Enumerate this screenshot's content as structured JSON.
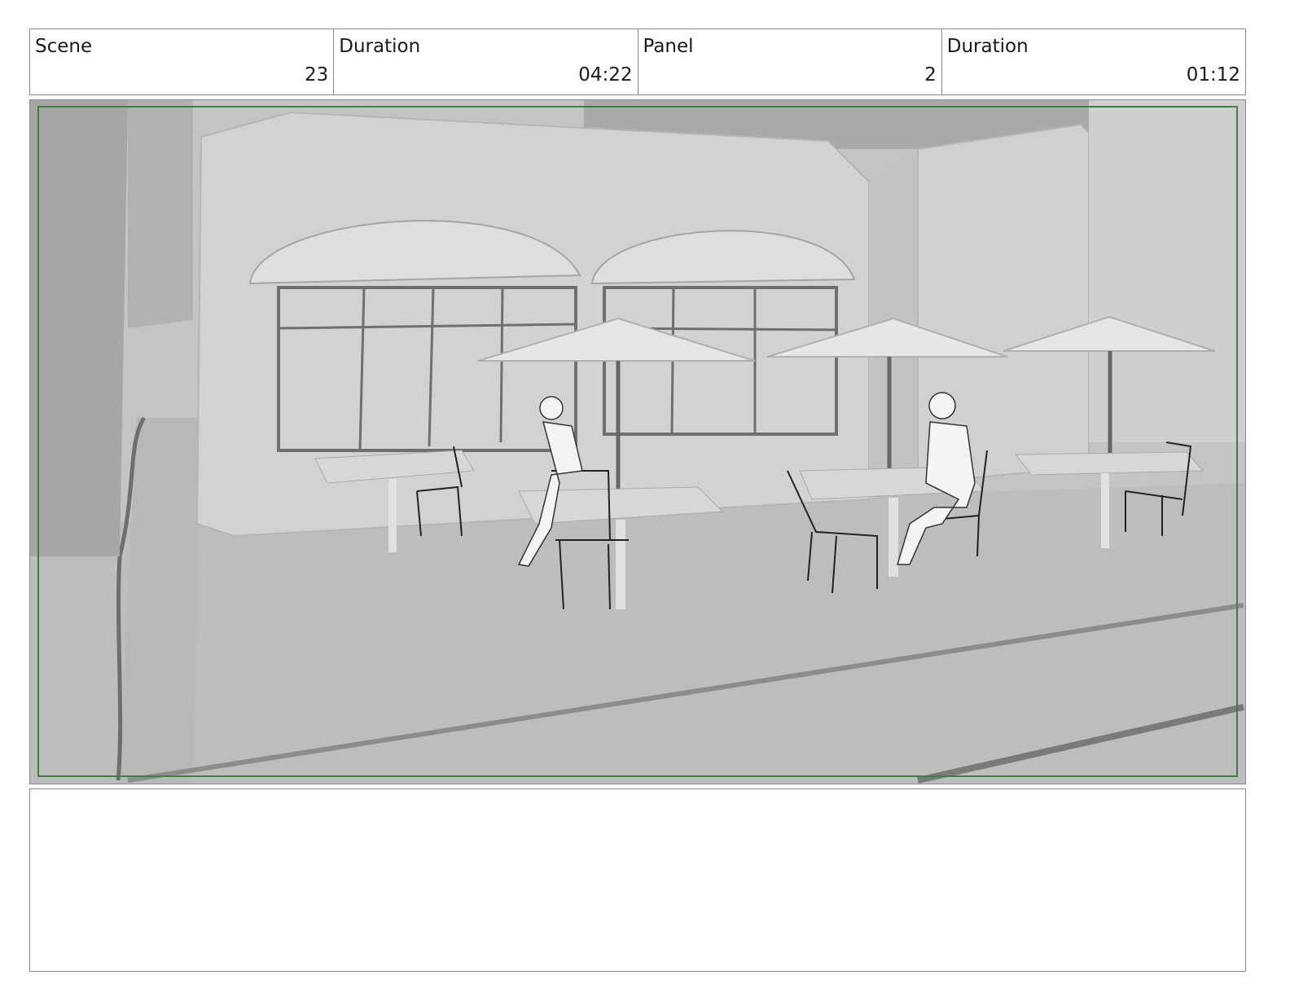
{
  "header": {
    "scene_label": "Scene",
    "scene_value": "23",
    "scene_duration_label": "Duration",
    "scene_duration_value": "04:22",
    "panel_label": "Panel",
    "panel_value": "2",
    "panel_duration_label": "Duration",
    "panel_duration_value": "01:12"
  },
  "notes": {
    "text": ""
  },
  "colors": {
    "border": "#8a8a8a",
    "safe_frame": "#3f7f3f",
    "sketch_background": "#c9c9c9"
  }
}
